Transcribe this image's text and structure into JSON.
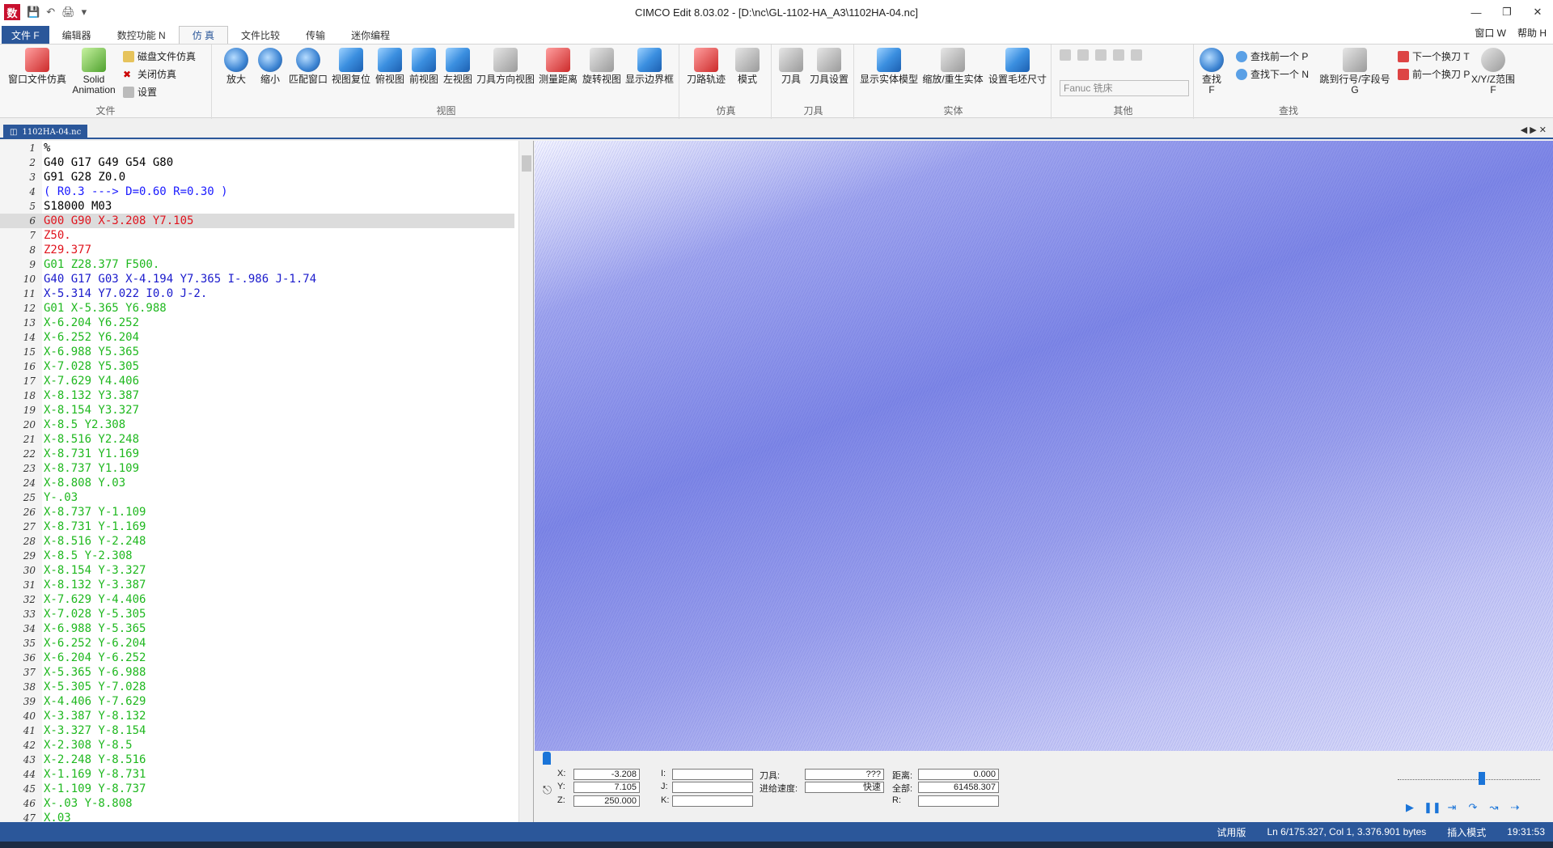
{
  "window": {
    "title": "CIMCO Edit 8.03.02 - [D:\\nc\\GL-1102-HA_A3\\1102HA-04.nc]",
    "app_icon": "数"
  },
  "menu": {
    "file": "文件 F",
    "tabs": [
      "编辑器",
      "数控功能 N",
      "仿 真",
      "文件比较",
      "传输",
      "迷你编程"
    ],
    "active_tab": 2,
    "right": [
      "窗口 W",
      "帮助 H"
    ]
  },
  "ribbon": {
    "file_group": {
      "label": "文件",
      "buttons": [
        "窗口文件仿真",
        "Solid Animation"
      ],
      "small": [
        "磁盘文件仿真",
        "关闭仿真",
        "设置"
      ]
    },
    "view_group": {
      "label": "视图",
      "buttons": [
        "放大",
        "缩小",
        "匹配窗口",
        "视图复位",
        "俯视图",
        "前视图",
        "左视图",
        "刀具方向视图",
        "测量距离",
        "旋转视图",
        "显示边界框"
      ]
    },
    "sim_group": {
      "label": "仿真",
      "buttons": [
        "刀路轨迹",
        "模式"
      ]
    },
    "tool_group": {
      "label": "刀具",
      "buttons": [
        "刀具",
        "刀具设置"
      ]
    },
    "solid_group": {
      "label": "实体",
      "buttons": [
        "显示实体模型",
        "缩放/重生实体",
        "设置毛坯尺寸"
      ]
    },
    "other_group": {
      "label": "其他",
      "combo": "Fanuc 铣床"
    },
    "find_group": {
      "label": "查找",
      "buttons": [
        "查找 F",
        "跳到行号/字段号 G",
        "X/Y/Z范围 F"
      ],
      "small": [
        "查找前一个 P",
        "查找下一个 N",
        "下一个换刀 T",
        "前一个换刀 P"
      ]
    }
  },
  "editor": {
    "tab_label": "1102HA-04.nc",
    "lines": [
      {
        "n": "1",
        "t": "%",
        "c": "#000000"
      },
      {
        "n": "2",
        "t": "G40 G17 G49 G54 G80",
        "c": "#000000"
      },
      {
        "n": "3",
        "t": "G91 G28 Z0.0",
        "c": "#000000"
      },
      {
        "n": "4",
        "t": "( R0.3 ---> D=0.60 R=0.30 )",
        "c": "#1a1aff"
      },
      {
        "n": "5",
        "t": "S18000 M03",
        "c": "#000000"
      },
      {
        "n": "6",
        "t": "G00 G90 X-3.208 Y7.105",
        "c": "#e0141e"
      },
      {
        "n": "7",
        "t": "Z50.",
        "c": "#e0141e"
      },
      {
        "n": "8",
        "t": "Z29.377",
        "c": "#e0141e"
      },
      {
        "n": "9",
        "t": "G01 Z28.377 F500.",
        "c": "#1fb81f"
      },
      {
        "n": "10",
        "t": "G40 G17 G03 X-4.194 Y7.365 I-.986 J-1.74",
        "c": "#1a1acc"
      },
      {
        "n": "11",
        "t": "X-5.314 Y7.022 I0.0 J-2.",
        "c": "#1a1acc"
      },
      {
        "n": "12",
        "t": "G01 X-5.365 Y6.988",
        "c": "#1fb81f"
      },
      {
        "n": "13",
        "t": "X-6.204 Y6.252",
        "c": "#1fb81f"
      },
      {
        "n": "14",
        "t": "X-6.252 Y6.204",
        "c": "#1fb81f"
      },
      {
        "n": "15",
        "t": "X-6.988 Y5.365",
        "c": "#1fb81f"
      },
      {
        "n": "16",
        "t": "X-7.028 Y5.305",
        "c": "#1fb81f"
      },
      {
        "n": "17",
        "t": "X-7.629 Y4.406",
        "c": "#1fb81f"
      },
      {
        "n": "18",
        "t": "X-8.132 Y3.387",
        "c": "#1fb81f"
      },
      {
        "n": "19",
        "t": "X-8.154 Y3.327",
        "c": "#1fb81f"
      },
      {
        "n": "20",
        "t": "X-8.5 Y2.308",
        "c": "#1fb81f"
      },
      {
        "n": "21",
        "t": "X-8.516 Y2.248",
        "c": "#1fb81f"
      },
      {
        "n": "22",
        "t": "X-8.731 Y1.169",
        "c": "#1fb81f"
      },
      {
        "n": "23",
        "t": "X-8.737 Y1.109",
        "c": "#1fb81f"
      },
      {
        "n": "24",
        "t": "X-8.808 Y.03",
        "c": "#1fb81f"
      },
      {
        "n": "25",
        "t": "Y-.03",
        "c": "#1fb81f"
      },
      {
        "n": "26",
        "t": "X-8.737 Y-1.109",
        "c": "#1fb81f"
      },
      {
        "n": "27",
        "t": "X-8.731 Y-1.169",
        "c": "#1fb81f"
      },
      {
        "n": "28",
        "t": "X-8.516 Y-2.248",
        "c": "#1fb81f"
      },
      {
        "n": "29",
        "t": "X-8.5 Y-2.308",
        "c": "#1fb81f"
      },
      {
        "n": "30",
        "t": "X-8.154 Y-3.327",
        "c": "#1fb81f"
      },
      {
        "n": "31",
        "t": "X-8.132 Y-3.387",
        "c": "#1fb81f"
      },
      {
        "n": "32",
        "t": "X-7.629 Y-4.406",
        "c": "#1fb81f"
      },
      {
        "n": "33",
        "t": "X-7.028 Y-5.305",
        "c": "#1fb81f"
      },
      {
        "n": "34",
        "t": "X-6.988 Y-5.365",
        "c": "#1fb81f"
      },
      {
        "n": "35",
        "t": "X-6.252 Y-6.204",
        "c": "#1fb81f"
      },
      {
        "n": "36",
        "t": "X-6.204 Y-6.252",
        "c": "#1fb81f"
      },
      {
        "n": "37",
        "t": "X-5.365 Y-6.988",
        "c": "#1fb81f"
      },
      {
        "n": "38",
        "t": "X-5.305 Y-7.028",
        "c": "#1fb81f"
      },
      {
        "n": "39",
        "t": "X-4.406 Y-7.629",
        "c": "#1fb81f"
      },
      {
        "n": "40",
        "t": "X-3.387 Y-8.132",
        "c": "#1fb81f"
      },
      {
        "n": "41",
        "t": "X-3.327 Y-8.154",
        "c": "#1fb81f"
      },
      {
        "n": "42",
        "t": "X-2.308 Y-8.5",
        "c": "#1fb81f"
      },
      {
        "n": "43",
        "t": "X-2.248 Y-8.516",
        "c": "#1fb81f"
      },
      {
        "n": "44",
        "t": "X-1.169 Y-8.731",
        "c": "#1fb81f"
      },
      {
        "n": "45",
        "t": "X-1.109 Y-8.737",
        "c": "#1fb81f"
      },
      {
        "n": "46",
        "t": "X-.03 Y-8.808",
        "c": "#1fb81f"
      },
      {
        "n": "47",
        "t": "X.03",
        "c": "#1fb81f"
      }
    ],
    "highlight_line": 6
  },
  "readouts": {
    "x_label": "X:",
    "x": "-3.208",
    "y_label": "Y:",
    "y": "7.105",
    "z_label": "Z:",
    "z": "250.000",
    "i_label": "I:",
    "j_label": "J:",
    "k_label": "K:",
    "tool_label": "刀具:",
    "tool": "???",
    "feed_label": "进给速度:",
    "feed": "快速",
    "dist_label": "距离:",
    "dist": "0.000",
    "total_label": "全部:",
    "total": "61458.307",
    "r_label": "R:"
  },
  "status": {
    "trial": "试用版",
    "position": "Ln 6/175.327, Col 1, 3.376.901 bytes",
    "mode": "插入模式",
    "time": "19:31:53"
  },
  "colors": {
    "accent": "#2b579a"
  }
}
